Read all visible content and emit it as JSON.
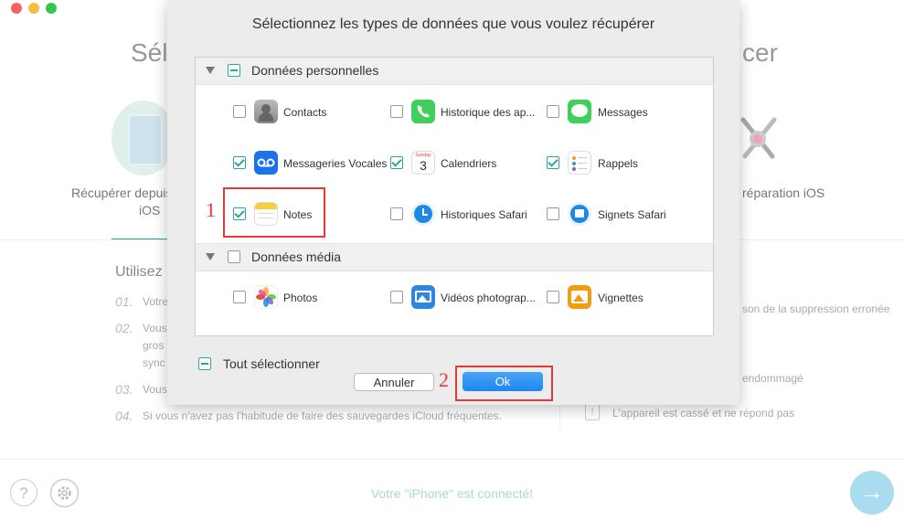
{
  "background": {
    "heading_left": "Sél",
    "heading_right": "cer",
    "mode_left_label_1": "Récupérer depuis",
    "mode_left_label_2": "iOS",
    "mode_right_label": "réparation iOS",
    "usage_heading": "Utilisez",
    "list": [
      {
        "num": "01.",
        "text": "Votre"
      },
      {
        "num": "02.",
        "text": "Vous"
      },
      {
        "num": "",
        "text": "gros"
      },
      {
        "num": "",
        "text": "sync"
      },
      {
        "num": "03.",
        "text": "Vous"
      },
      {
        "num": "04.",
        "text": "Si vous n'avez pas l'habitude de faire des sauvegardes iCloud fréquentes."
      }
    ],
    "right_list": [
      "son de la suppression erronée",
      "endommagé",
      "L'appareil est cassé et ne répond pas"
    ],
    "status": "Votre \"iPhone\" est connecté!",
    "help_glyph": "?",
    "next_glyph": "→"
  },
  "dialog": {
    "title": "Sélectionnez les types de données que vous voulez récupérer",
    "sections": [
      {
        "label": "Données personnelles",
        "state": "partial",
        "items": [
          {
            "label": "Contacts",
            "checked": false,
            "icon": "contacts-icon"
          },
          {
            "label": "Historique des ap...",
            "checked": false,
            "icon": "phone-icon"
          },
          {
            "label": "Messages",
            "checked": false,
            "icon": "messages-icon"
          },
          {
            "label": "Messageries Vocales",
            "checked": true,
            "icon": "voicemail-icon"
          },
          {
            "label": "Calendriers",
            "checked": true,
            "icon": "calendar-icon"
          },
          {
            "label": "Rappels",
            "checked": true,
            "icon": "reminders-icon"
          },
          {
            "label": "Notes",
            "checked": true,
            "icon": "notes-icon"
          },
          {
            "label": "Historiques Safari",
            "checked": false,
            "icon": "safari-history-icon"
          },
          {
            "label": "Signets Safari",
            "checked": false,
            "icon": "safari-bookmarks-icon"
          }
        ]
      },
      {
        "label": "Données média",
        "state": "unchecked",
        "items": [
          {
            "label": "Photos",
            "checked": false,
            "icon": "photos-icon"
          },
          {
            "label": "Vidéos photograp...",
            "checked": false,
            "icon": "photo-videos-icon"
          },
          {
            "label": "Vignettes",
            "checked": false,
            "icon": "thumbnails-icon"
          }
        ]
      }
    ],
    "calendar_day": "Sunday",
    "calendar_date": "3",
    "select_all": "Tout sélectionner",
    "cancel": "Annuler",
    "ok": "Ok"
  },
  "annotations": {
    "step1": "1",
    "step2": "2"
  },
  "colors": {
    "accent": "#2aa79a",
    "ok_blue": "#1c87f0",
    "annotation_red": "#e53935"
  }
}
